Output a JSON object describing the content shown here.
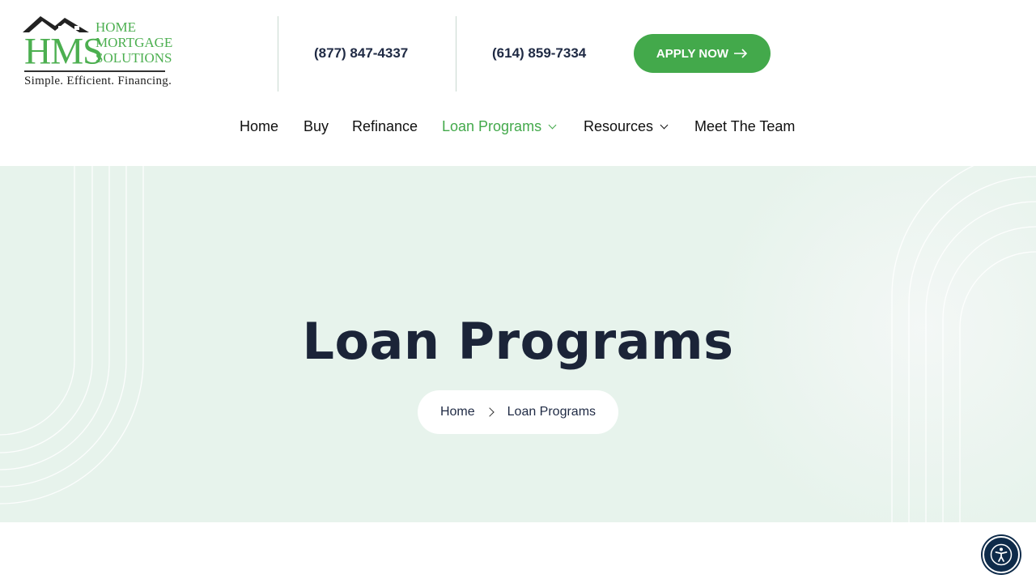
{
  "brand": {
    "logo_letters": "HMS",
    "logo_words": [
      "HOME",
      "MORTGAGE",
      "SOLUTIONS"
    ],
    "tagline": "Simple. Efficient. Financing.",
    "accent_color": "#43a94b",
    "dark_color": "#1b2438"
  },
  "header": {
    "phone_1": "(877) 847-4337",
    "phone_2": "(614) 859-7334",
    "apply_label": "APPLY NOW",
    "apply_icon": "arrow-right-icon"
  },
  "nav": {
    "items": [
      {
        "label": "Home",
        "dropdown": false,
        "active": false
      },
      {
        "label": "Buy",
        "dropdown": false,
        "active": false
      },
      {
        "label": "Refinance",
        "dropdown": false,
        "active": false
      },
      {
        "label": "Loan Programs",
        "dropdown": true,
        "active": true
      },
      {
        "label": "Resources",
        "dropdown": true,
        "active": false
      },
      {
        "label": "Meet The Team",
        "dropdown": false,
        "active": false
      }
    ]
  },
  "hero": {
    "title": "Loan Programs",
    "breadcrumb": {
      "home": "Home",
      "current": "Loan Programs",
      "separator_icon": "chevron-right-icon"
    }
  },
  "accessibility": {
    "icon": "accessibility-icon"
  }
}
